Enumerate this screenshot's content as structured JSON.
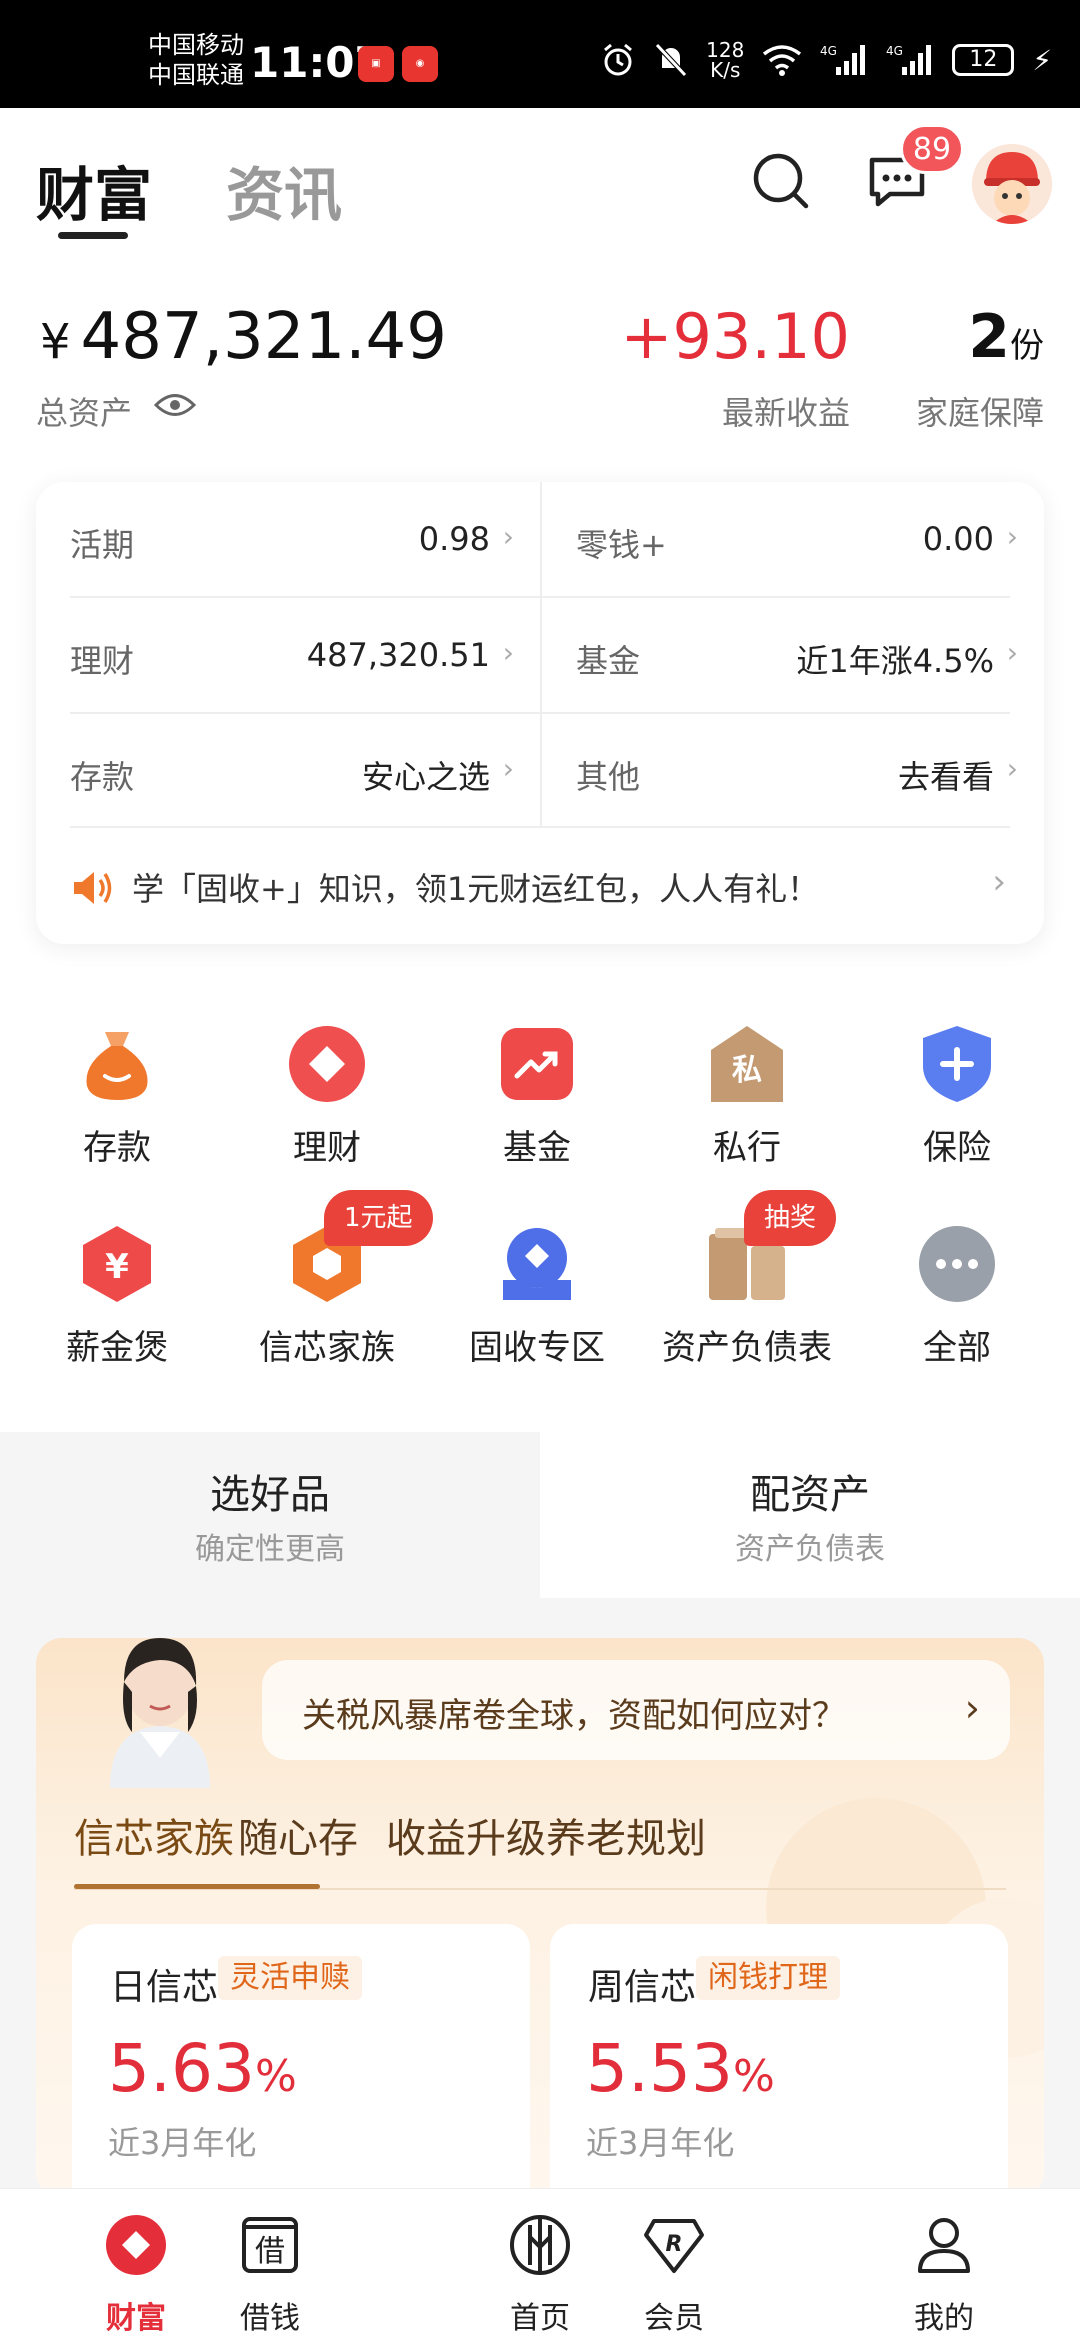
{
  "status_bar": {
    "carrier1": "中国移动",
    "carrier2": "中国联通",
    "time": "11:07",
    "net_speed_value": "128",
    "net_speed_unit": "K/s",
    "signal1": "4G",
    "signal2": "4G",
    "battery": "12"
  },
  "header": {
    "tab_active": "财富",
    "tab_inactive": "资讯",
    "message_badge": "89",
    "icons": [
      "search-icon",
      "message-icon",
      "avatar"
    ]
  },
  "assets": {
    "currency": "¥",
    "total": "487,321.49",
    "total_label": "总资产",
    "income": "+93.10",
    "income_label": "最新收益",
    "protection_value": "2",
    "protection_unit": "份",
    "protection_label": "家庭保障"
  },
  "summary": {
    "rows": [
      {
        "left_label": "活期",
        "left_value": "0.98",
        "right_label": "零钱+",
        "right_value": "0.00"
      },
      {
        "left_label": "理财",
        "left_value": "487,320.51",
        "right_label": "基金",
        "right_value": "近1年涨4.5%"
      },
      {
        "left_label": "存款",
        "left_value": "安心之选",
        "right_label": "其他",
        "right_value": "去看看"
      }
    ],
    "notice": "学「固收+」知识，领1元财运红包，人人有礼！"
  },
  "grid": [
    {
      "label": "存款",
      "icon": "money-bag-icon",
      "color": "#f0782c"
    },
    {
      "label": "理财",
      "icon": "diamond-icon",
      "color": "#ef4f4f"
    },
    {
      "label": "基金",
      "icon": "trend-icon",
      "color": "#ee4a4a"
    },
    {
      "label": "私行",
      "icon": "private-bank-icon",
      "color": "#c49a73",
      "glyph": "私"
    },
    {
      "label": "保险",
      "icon": "shield-icon",
      "color": "#5a7df0"
    },
    {
      "label": "薪金煲",
      "icon": "yen-icon",
      "color": "#ee4a4a",
      "glyph": "¥"
    },
    {
      "label": "信芯家族",
      "icon": "hexagon-icon",
      "color": "#f0782c",
      "tag": "1元起"
    },
    {
      "label": "固收专区",
      "icon": "fixed-income-icon",
      "color": "#4f6fe8"
    },
    {
      "label": "资产负债表",
      "icon": "balance-sheet-icon",
      "color": "#c49a73",
      "tag": "抽奖"
    },
    {
      "label": "全部",
      "icon": "more-icon",
      "color": "#9aa0aa"
    }
  ],
  "segments": [
    {
      "title": "选好品",
      "subtitle": "确定性更高"
    },
    {
      "title": "配资产",
      "subtitle": "资产负债表"
    }
  ],
  "promo": {
    "bubble_text": "关税风暴席卷全球，资配如何应对？",
    "tabs": [
      "信芯家族",
      "随心存",
      "收益升级",
      "养老规划"
    ],
    "products": [
      {
        "name": "日信芯",
        "chip": "灵活申赎",
        "rate": "5.63",
        "rate_unit": "%",
        "desc": "近3月年化"
      },
      {
        "name": "周信芯",
        "chip": "闲钱打理",
        "rate": "5.53",
        "rate_unit": "%",
        "desc": "近3月年化"
      }
    ]
  },
  "bottom_nav": [
    {
      "label": "财富",
      "icon": "wealth-icon",
      "active": true
    },
    {
      "label": "借钱",
      "icon": "borrow-icon",
      "glyph": "借"
    },
    {
      "label": "首页",
      "icon": "home-icon"
    },
    {
      "label": "会员",
      "icon": "member-icon"
    },
    {
      "label": "我的",
      "icon": "profile-icon"
    }
  ],
  "colors": {
    "accent_red": "#e42f3b",
    "gold_text": "#5a3b1c",
    "chip_orange": "#e0661a"
  }
}
